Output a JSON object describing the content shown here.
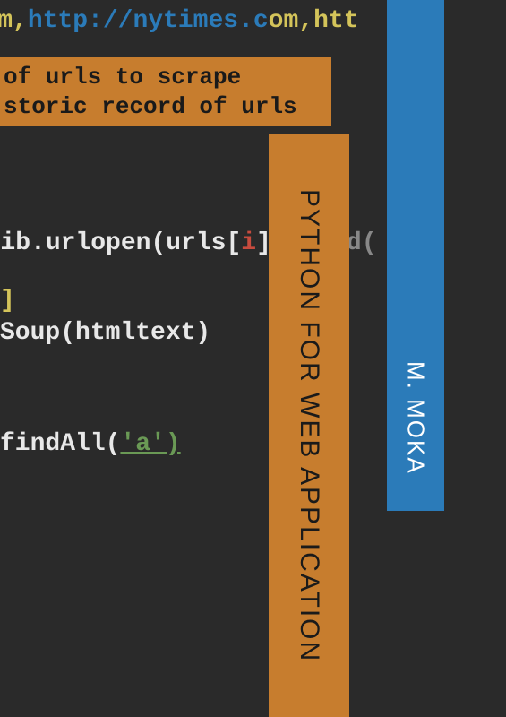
{
  "title": "PYTHON FOR WEB APPLICATION",
  "author": "M. MOKA",
  "code": {
    "line1_pre": "s.com,",
    "line1_url": "http://nytimes.c",
    "line1_tld": "om",
    "line1_post": ",htt",
    "comment1": " of urls to scrape",
    "comment2": "storic record of urls",
    "urllib_a": "rllib.urlopen(urls[",
    "urllib_idx": "i",
    "urllib_b": "])",
    "urllib_c": ".read(",
    "bracket": "]",
    "soup": "Soup(htmltext)",
    "findall_a": "findAll(",
    "findall_b": "'a')"
  }
}
